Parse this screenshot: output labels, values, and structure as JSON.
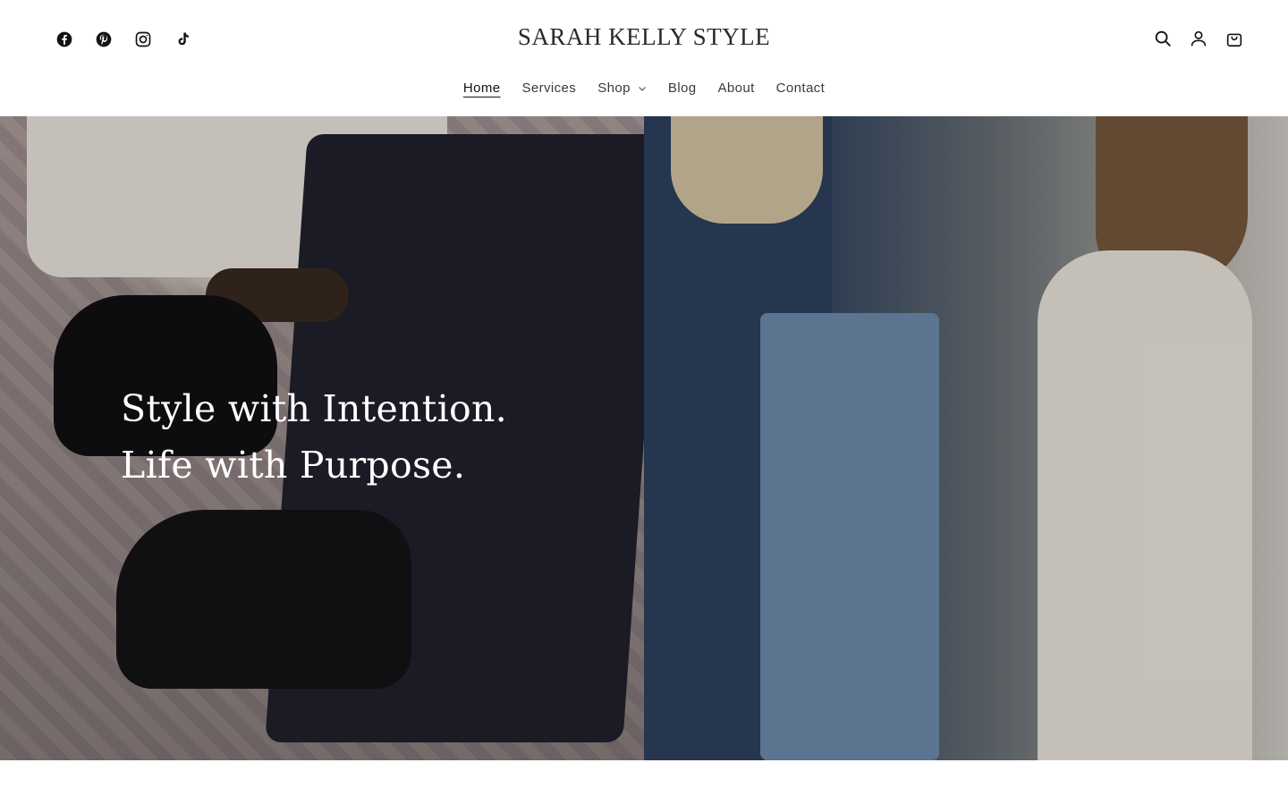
{
  "header": {
    "logo": "SARAH KELLY STYLE",
    "social": [
      {
        "name": "facebook",
        "icon": "facebook-icon"
      },
      {
        "name": "pinterest",
        "icon": "pinterest-icon"
      },
      {
        "name": "instagram",
        "icon": "instagram-icon"
      },
      {
        "name": "tiktok",
        "icon": "tiktok-icon"
      }
    ],
    "utilities": {
      "search": "search-icon",
      "account": "account-icon",
      "cart": "cart-icon"
    }
  },
  "nav": {
    "items": [
      {
        "label": "Home",
        "active": true
      },
      {
        "label": "Services"
      },
      {
        "label": "Shop",
        "has_dropdown": true
      },
      {
        "label": "Blog"
      },
      {
        "label": "About"
      },
      {
        "label": "Contact"
      }
    ]
  },
  "hero": {
    "line1": "Style with Intention.",
    "line2": "Life with Purpose."
  },
  "colors": {
    "text": "#121212",
    "hero_text": "#ffffff",
    "background": "#ffffff"
  }
}
